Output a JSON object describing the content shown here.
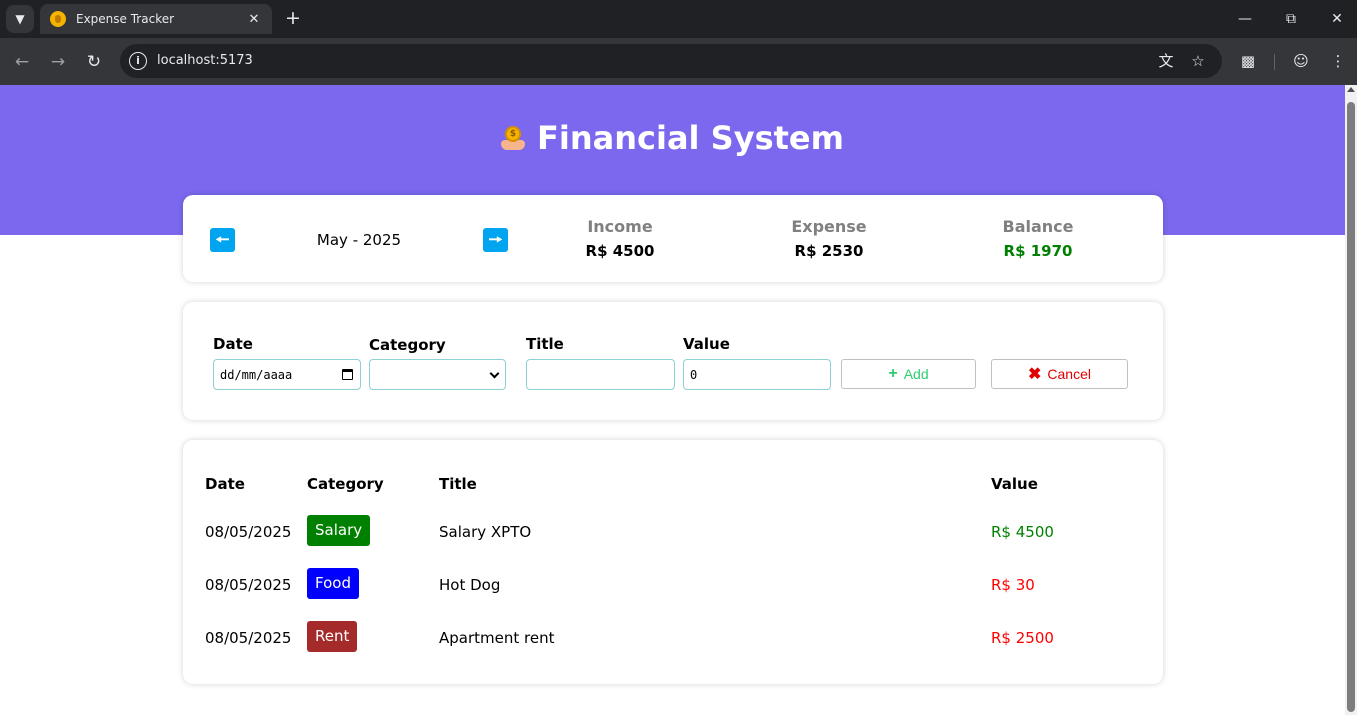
{
  "browser": {
    "tab_title": "Expense Tracker",
    "url": "localhost:5173"
  },
  "header": {
    "title": "Financial System"
  },
  "summary": {
    "prev_icon": "arrow-left",
    "next_icon": "arrow-right",
    "month_label": "May - 2025",
    "income_label": "Income",
    "income_value": "R$ 4500",
    "expense_label": "Expense",
    "expense_value": "R$ 2530",
    "balance_label": "Balance",
    "balance_value": "R$ 1970"
  },
  "form": {
    "date_label": "Date",
    "date_placeholder": "dd/mm/aaaa",
    "category_label": "Category",
    "category_value": "",
    "title_label": "Title",
    "title_value": "",
    "value_label": "Value",
    "value_value": "0",
    "add_label": "Add",
    "cancel_label": "Cancel"
  },
  "table": {
    "columns": {
      "date": "Date",
      "category": "Category",
      "title": "Title",
      "value": "Value"
    },
    "rows": [
      {
        "date": "08/05/2025",
        "category": "Salary",
        "category_color": "#008000",
        "title": "Salary XPTO",
        "value": "R$ 4500",
        "value_color": "#008000"
      },
      {
        "date": "08/05/2025",
        "category": "Food",
        "category_color": "#0000ff",
        "title": "Hot Dog",
        "value": "R$ 30",
        "value_color": "#ff0000"
      },
      {
        "date": "08/05/2025",
        "category": "Rent",
        "category_color": "#a52a2a",
        "title": "Apartment rent",
        "value": "R$ 2500",
        "value_color": "#ff0000"
      }
    ]
  },
  "colors": {
    "header_bg": "#7b68ee",
    "arrow_button": "#00a4ef",
    "balance_positive": "#008000",
    "add_button_text": "#2ecc71",
    "cancel_button_text": "#e00000"
  }
}
